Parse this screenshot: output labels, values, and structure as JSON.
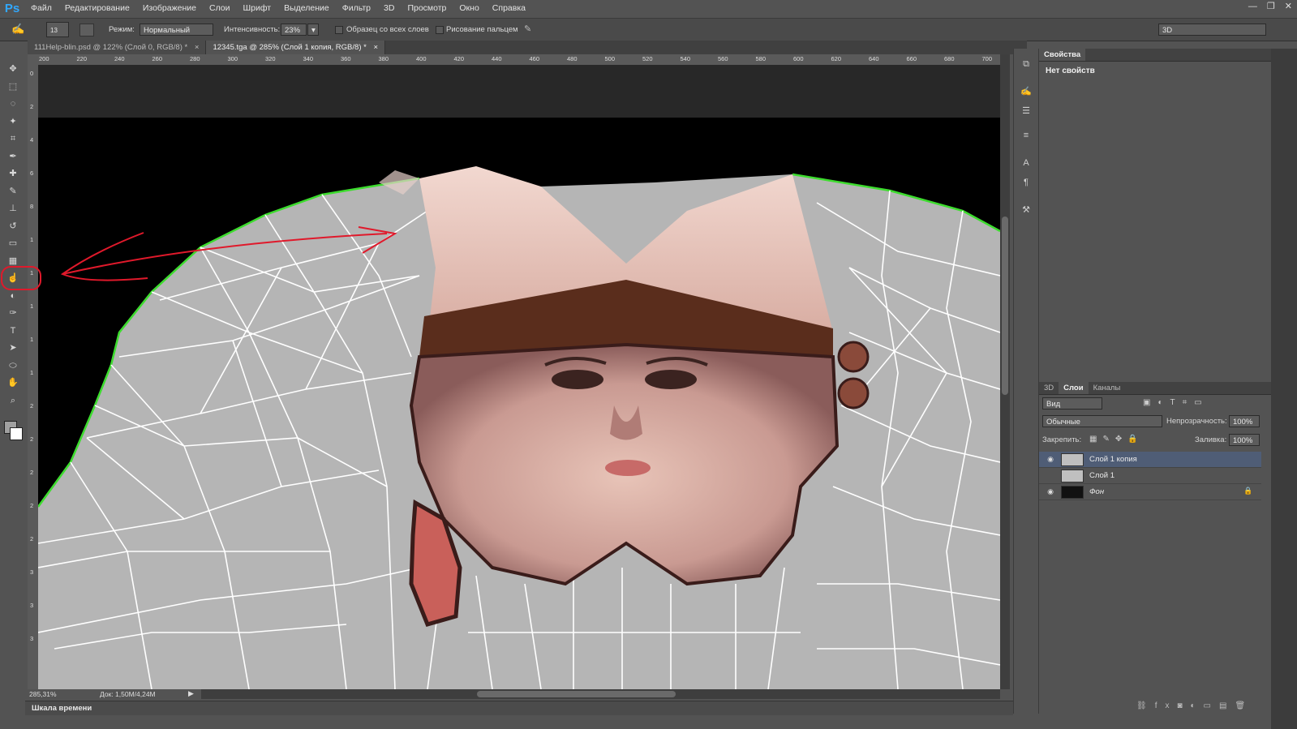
{
  "app": {
    "logo": "Ps",
    "accent": "#31a8ff"
  },
  "menu": [
    "Файл",
    "Редактирование",
    "Изображение",
    "Слои",
    "Шрифт",
    "Выделение",
    "Фильтр",
    "3D",
    "Просмотр",
    "Окно",
    "Справка"
  ],
  "window_controls": {
    "minimize": "—",
    "restore": "❐",
    "close": "✕"
  },
  "options": {
    "brush_size": "13",
    "mode_label": "Режим:",
    "mode_value": "Нормальный",
    "strength_label": "Интенсивность:",
    "strength_value": "23%",
    "sample_all_label": "Образец со всех слоев",
    "finger_label": "Рисование пальцем",
    "workspace": "3D"
  },
  "tabs": [
    {
      "label": "111Help-blin.psd @ 122% (Слой 0, RGB/8) *",
      "close": "×"
    },
    {
      "label": "12345.tga @ 285% (Слой 1 копия, RGB/8) *",
      "close": "×"
    }
  ],
  "ruler_top": [
    "200",
    "220",
    "240",
    "260",
    "280",
    "300",
    "320",
    "340",
    "360",
    "380",
    "400",
    "420",
    "440",
    "460",
    "480",
    "500",
    "520",
    "540",
    "560",
    "580",
    "600",
    "620",
    "640",
    "660",
    "680",
    "700"
  ],
  "ruler_left": [
    "0",
    "2",
    "4",
    "6",
    "8",
    "1",
    "1",
    "1",
    "1",
    "1",
    "2",
    "2",
    "2",
    "2",
    "2",
    "3",
    "3",
    "3"
  ],
  "status": {
    "zoom": "285,31%",
    "doc": "Док: 1,50M/4,24M"
  },
  "timeline_label": "Шкала времени",
  "properties": {
    "tab": "Свойства",
    "empty_text": "Нет свойств"
  },
  "layers_panel": {
    "tabs": [
      "3D",
      "Слои",
      "Каналы"
    ],
    "filter_kind": "Вид",
    "blend_mode": "Обычные",
    "opacity_label": "Непрозрачность:",
    "opacity_value": "100%",
    "lock_label": "Закрепить:",
    "fill_label": "Заливка:",
    "fill_value": "100%",
    "layers": [
      {
        "name": "Слой 1 копия",
        "visible": true,
        "selected": true
      },
      {
        "name": "Слой 1",
        "visible": false,
        "selected": false
      },
      {
        "name": "Фон",
        "visible": true,
        "selected": false,
        "locked": true
      }
    ]
  },
  "tools": [
    "move-icon",
    "marquee-icon",
    "lasso-icon",
    "quick-select-icon",
    "crop-icon",
    "eyedropper-icon",
    "healing-icon",
    "brush-icon",
    "stamp-icon",
    "history-brush-icon",
    "eraser-icon",
    "gradient-icon",
    "smudge-icon",
    "dodge-icon",
    "pen-icon",
    "type-icon",
    "path-select-icon",
    "shape-icon",
    "hand-icon",
    "zoom-icon"
  ],
  "annotation_color": "#e0192b",
  "wireframe_edge_color": "#3ddc2e"
}
